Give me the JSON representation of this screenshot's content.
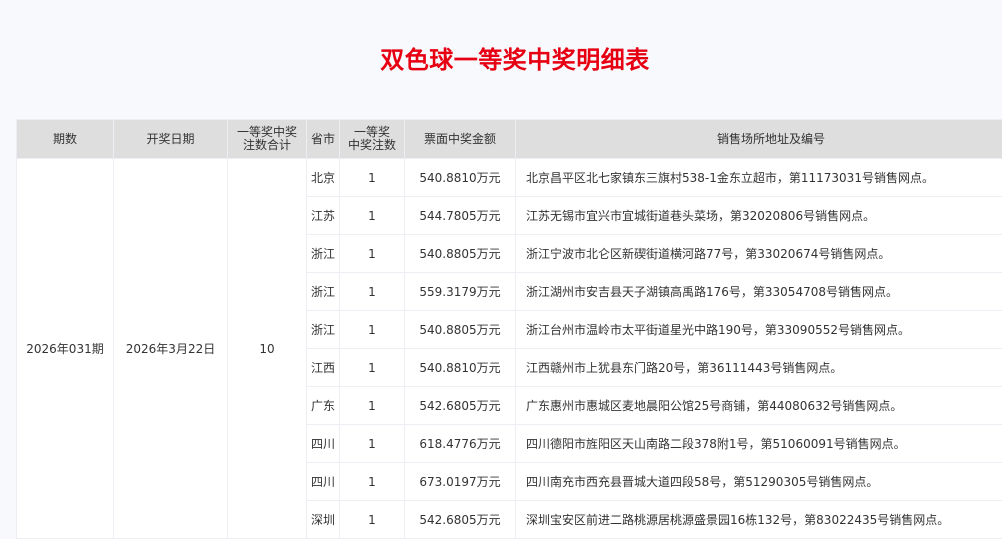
{
  "title": "双色球一等奖中奖明细表",
  "headers": [
    "期数",
    "开奖日期",
    "一等奖中奖\n注数合计",
    "省市",
    "一等奖\n中奖注数",
    "票面中奖金额",
    "销售场所地址及编号"
  ],
  "issue": "2026年031期",
  "date": "2026年3月22日",
  "total": "10",
  "rows": [
    {
      "prov": "北京",
      "count": "1",
      "amount": "540.8810万元",
      "addr": "北京昌平区北七家镇东三旗村538-1金东立超市，第11173031号销售网点。"
    },
    {
      "prov": "江苏",
      "count": "1",
      "amount": "544.7805万元",
      "addr": "江苏无锡市宜兴市宜城街道巷头菜场，第32020806号销售网点。"
    },
    {
      "prov": "浙江",
      "count": "1",
      "amount": "540.8805万元",
      "addr": "浙江宁波市北仑区新碶街道横河路77号，第33020674号销售网点。"
    },
    {
      "prov": "浙江",
      "count": "1",
      "amount": "559.3179万元",
      "addr": "浙江湖州市安吉县天子湖镇高禹路176号，第33054708号销售网点。"
    },
    {
      "prov": "浙江",
      "count": "1",
      "amount": "540.8805万元",
      "addr": "浙江台州市温岭市太平街道星光中路190号，第33090552号销售网点。"
    },
    {
      "prov": "江西",
      "count": "1",
      "amount": "540.8810万元",
      "addr": "江西赣州市上犹县东门路20号，第36111443号销售网点。"
    },
    {
      "prov": "广东",
      "count": "1",
      "amount": "542.6805万元",
      "addr": "广东惠州市惠城区麦地晨阳公馆25号商铺，第44080632号销售网点。"
    },
    {
      "prov": "四川",
      "count": "1",
      "amount": "618.4776万元",
      "addr": "四川德阳市旌阳区天山南路二段378附1号，第51060091号销售网点。"
    },
    {
      "prov": "四川",
      "count": "1",
      "amount": "673.0197万元",
      "addr": "四川南充市西充县晋城大道四段58号，第51290305号销售网点。"
    },
    {
      "prov": "深圳",
      "count": "1",
      "amount": "542.6805万元",
      "addr": "深圳宝安区前进二路桃源居桃源盛景园16栋132号，第83022435号销售网点。"
    }
  ]
}
